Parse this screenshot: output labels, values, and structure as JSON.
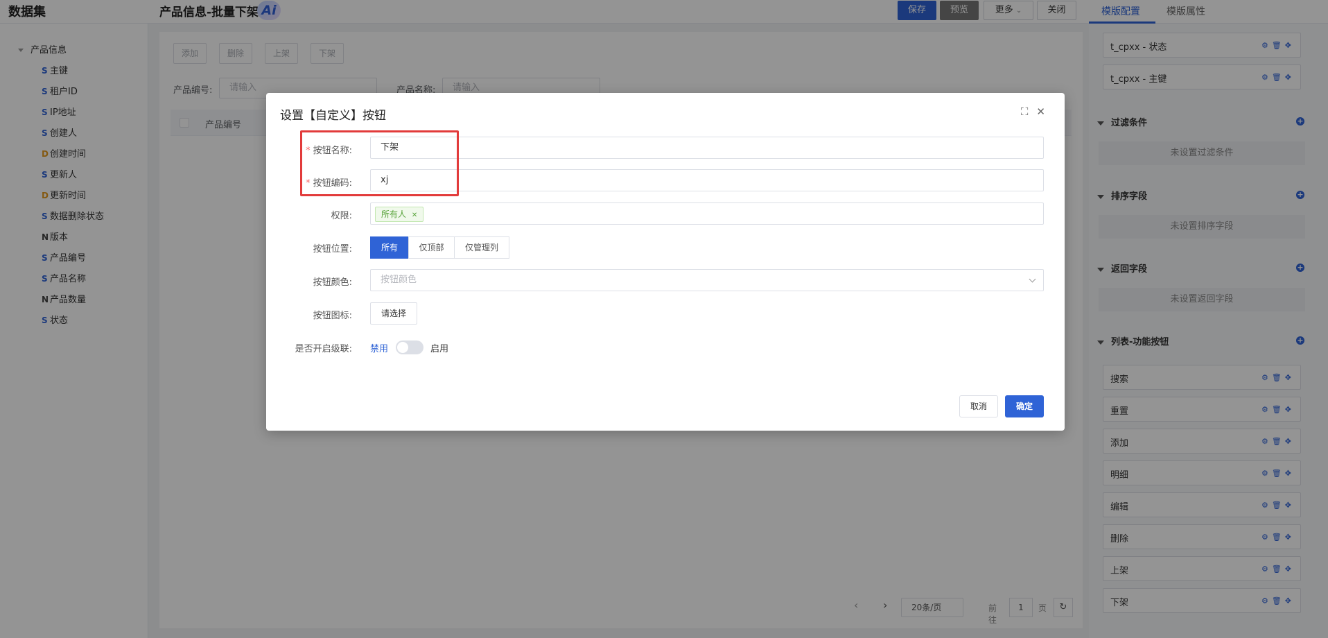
{
  "header": {
    "dataset_title": "数据集",
    "page_title": "产品信息-批量下架",
    "ai_label": "Ai",
    "save_label": "保存",
    "preview_label": "预览",
    "more_label": "更多",
    "close_label": "关闭"
  },
  "right_tabs": {
    "template_config": "模版配置",
    "template_props": "模版属性"
  },
  "tree": {
    "root": "产品信息",
    "items": [
      {
        "type": "S",
        "label": "主键"
      },
      {
        "type": "S",
        "label": "租户ID"
      },
      {
        "type": "S",
        "label": "IP地址"
      },
      {
        "type": "S",
        "label": "创建人"
      },
      {
        "type": "D",
        "label": "创建时间"
      },
      {
        "type": "S",
        "label": "更新人"
      },
      {
        "type": "D",
        "label": "更新时间"
      },
      {
        "type": "S",
        "label": "数据删除状态"
      },
      {
        "type": "N",
        "label": "版本"
      },
      {
        "type": "S",
        "label": "产品编号"
      },
      {
        "type": "S",
        "label": "产品名称"
      },
      {
        "type": "N",
        "label": "产品数量"
      },
      {
        "type": "S",
        "label": "状态"
      }
    ]
  },
  "center": {
    "buttons": [
      "添加",
      "删除",
      "上架",
      "下架"
    ],
    "filter1_label": "产品编号:",
    "filter1_placeholder": "请输入",
    "filter2_label": "产品名称:",
    "filter2_placeholder": "请输入",
    "col_header": "产品编号",
    "page_size": "20条/页",
    "goto_label": "前往",
    "goto_page": "1",
    "page_unit": "页"
  },
  "right_panel": {
    "top_items": [
      "t_cpxx - 状态",
      "t_cpxx - 主键"
    ],
    "filter_title": "过滤条件",
    "filter_empty": "未设置过滤条件",
    "sort_title": "排序字段",
    "sort_empty": "未设置排序字段",
    "return_title": "返回字段",
    "return_empty": "未设置返回字段",
    "buttons_title": "列表-功能按钮",
    "buttons": [
      "搜索",
      "重置",
      "添加",
      "明细",
      "编辑",
      "删除",
      "上架",
      "下架"
    ]
  },
  "modal": {
    "title": "设置【自定义】按钮",
    "name_label": "按钮名称:",
    "name_value": "下架",
    "code_label": "按钮编码:",
    "code_value": "xj",
    "perm_label": "权限:",
    "perm_tag": "所有人",
    "pos_label": "按钮位置:",
    "positions": [
      "所有",
      "仅顶部",
      "仅管理列"
    ],
    "color_label": "按钮颜色:",
    "color_placeholder": "按钮颜色",
    "icon_label": "按钮图标:",
    "icon_btn": "请选择",
    "cascade_label": "是否开启级联:",
    "cascade_off": "禁用",
    "cascade_on": "启用",
    "cancel": "取消",
    "ok": "确定"
  }
}
